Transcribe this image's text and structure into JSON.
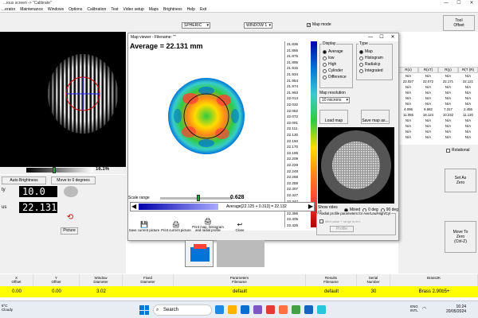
{
  "window": {
    "title": "...ious screen -> \"Calibrate\"",
    "menu": [
      "...erator",
      "Maintenance",
      "Windows",
      "Options",
      "Calibration",
      "Test",
      "Video setup",
      "Maps",
      "Brightness",
      "Help",
      "Exit"
    ],
    "min": "—",
    "max": "☐",
    "close": "✕"
  },
  "toolstrip": {
    "lens_type": "SPHERIC",
    "window_sel": "WINDOW 1",
    "map_mode_label": "Map mode",
    "map_mode_checked": true,
    "tool_offset": "Tool\nOffset"
  },
  "left": {
    "percent": "16.1%",
    "auto_brightness": "Auto Brightness",
    "move_zero": "Move to 0 degrees",
    "lcd1_prefix": "ty",
    "lcd1_value": "10.0",
    "lcd2_prefix": "us",
    "lcd2_value": "22.131",
    "picture_label": "Picture"
  },
  "right_table": {
    "headers": [
      "R(x)",
      "R(xT)",
      "R(y)",
      "R(T (R)"
    ],
    "rows": [
      [
        "N/A",
        "N/A",
        "N/A",
        "N/A"
      ],
      [
        "22.027",
        "22.072",
        "22.171",
        "22.121"
      ],
      [
        "N/A",
        "N/A",
        "N/A",
        "N/A"
      ],
      [
        "N/A",
        "N/A",
        "N/A",
        "N/A"
      ],
      [
        "N/A",
        "N/A",
        "N/A",
        "N/A"
      ],
      [
        "N/A",
        "N/A",
        "N/A",
        "N/A"
      ],
      [
        "4.096",
        "8.682",
        "7.317",
        "2.455"
      ],
      [
        "11.055",
        "18.124",
        "10.232",
        "11.120"
      ],
      [
        "N/A",
        "N/A",
        "N/A",
        "N/A"
      ],
      [
        "N/A",
        "N/A",
        "N/A",
        "N/A"
      ],
      [
        "N/A",
        "N/A",
        "N/A",
        "N/A"
      ],
      [
        "N/A",
        "N/A",
        "N/A",
        "N/A"
      ]
    ]
  },
  "right_panel": {
    "rotational": "Rotational",
    "set_as_zero": "Set As\nZero",
    "move_to_zero": "Move To\nZero\n(Ctrl-Z)"
  },
  "dialog": {
    "title": "Map viewer - Filename: \"\"",
    "average_text": "Average = 22.131 mm",
    "scale_values": [
      "21.836",
      "21.856",
      "21.875",
      "21.895",
      "21.915",
      "21.934",
      "21.954",
      "21.974",
      "21.993",
      "22.013",
      "22.032",
      "22.052",
      "22.072",
      "22.091",
      "22.111",
      "22.130",
      "22.150",
      "22.170",
      "22.189",
      "22.209",
      "22.229",
      "22.248",
      "22.268",
      "22.288",
      "22.307",
      "22.327",
      "22.347",
      "22.366",
      "22.386",
      "22.405",
      "22.425"
    ],
    "display_group": "Display",
    "display_options": [
      "Average",
      "low",
      "High",
      "Cylinder",
      "Difference"
    ],
    "display_selected": 0,
    "type_group": "Type",
    "type_options": [
      "Map",
      "Histogram",
      "Radialcp",
      "Integrated"
    ],
    "type_selected": 0,
    "map_resolution_label": "Map resolution",
    "map_resolution_value": "10 microns",
    "load_map": "Load map",
    "save_map": "Save map as...",
    "scale_range_label": "Scale range",
    "scale_range_value": "0.628",
    "slider_text": "Average[22.125 + 0.313] = 22.132",
    "show_rides_label": "Show rides at:",
    "rides_options": [
      "Mixed",
      "0 deg",
      "90 deg"
    ],
    "rides_selected": 0,
    "radial_group": "Radial profile parameters for Ave/Low/High/Cyl",
    "radial_check": "Mint value + range is em.",
    "profile_btn": "Profile",
    "buttons": [
      "Save current picture",
      "Print current picture",
      "Print map, histogram and radial profile",
      "Close"
    ],
    "scale_fill_fraction": 0.6
  },
  "bottom": {
    "headers": [
      "X\nOffset",
      "Y\nOffset",
      "Window\nDiameter",
      "Fixed\nDiameter",
      "Parameters\nFilename",
      "Results\nFilename",
      "Serial\nNumber",
      "Brass2K"
    ],
    "values": [
      "0.00",
      "0.00",
      "3.02",
      "",
      "default",
      "default",
      "30",
      "Brass 2.90b5+"
    ]
  },
  "taskbar": {
    "weather": "8°C\nCloudy",
    "search": "Search",
    "lang": "ENG\nINTL",
    "time": "16:24",
    "date": "20/05/2024"
  },
  "colors": {
    "lcd_bg": "#000000",
    "yellow": "#ffff00",
    "accent": "#0078d4"
  }
}
